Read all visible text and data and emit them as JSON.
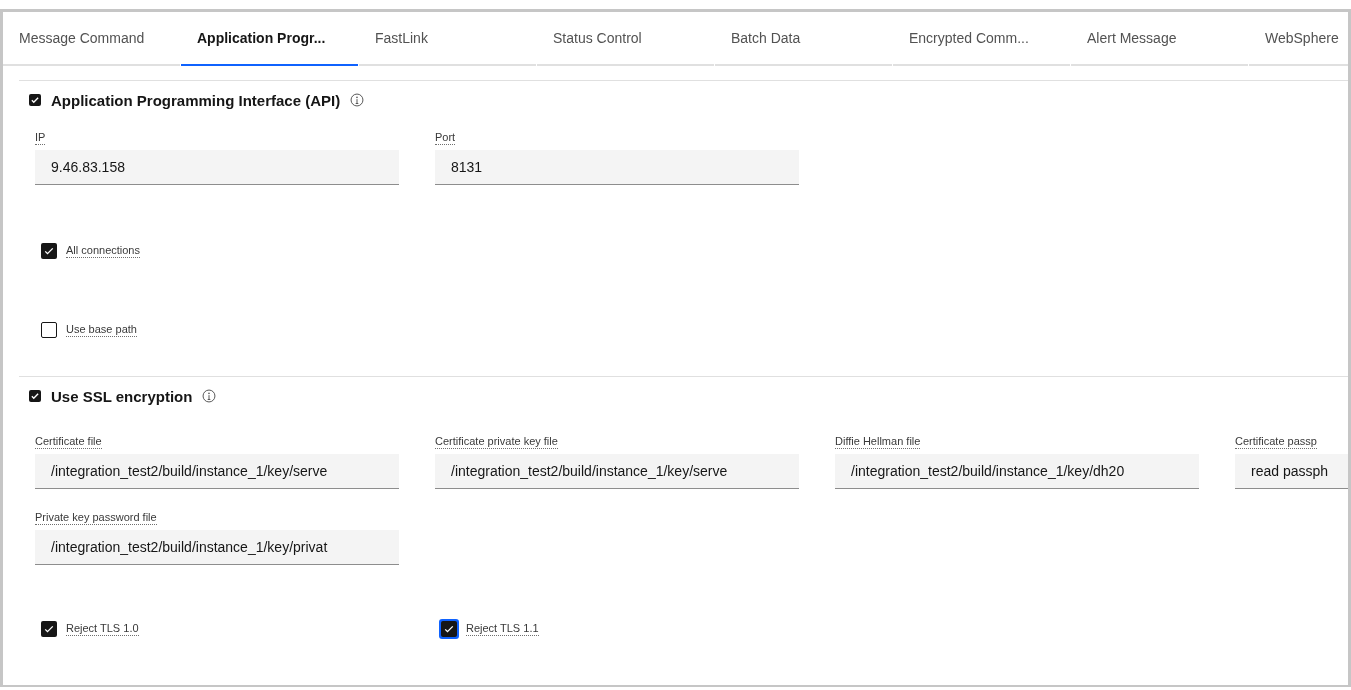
{
  "tabs": [
    {
      "label": "Message Command",
      "selected": false
    },
    {
      "label": "Application Progr...",
      "selected": true
    },
    {
      "label": "FastLink",
      "selected": false
    },
    {
      "label": "Status Control",
      "selected": false
    },
    {
      "label": "Batch Data",
      "selected": false
    },
    {
      "label": "Encrypted Comm...",
      "selected": false
    },
    {
      "label": "Alert Message",
      "selected": false
    },
    {
      "label": "WebSphere",
      "selected": false
    }
  ],
  "sections": [
    {
      "title": "Application Programming Interface (API)",
      "checked": true,
      "kind": "stack",
      "fields": [
        {
          "label": "IP",
          "value": "9.46.83.158"
        },
        {
          "label": "Port",
          "value": "8131"
        }
      ],
      "options": [
        {
          "label": "All connections",
          "checked": true,
          "focused": false
        },
        {
          "label": "Use base path",
          "checked": false,
          "focused": false
        }
      ]
    },
    {
      "title": "Use SSL encryption",
      "checked": true,
      "kind": "row",
      "fields": [
        {
          "label": "Certificate file",
          "value": "/integration_test2/build/instance_1/key/serve"
        },
        {
          "label": "Certificate private key file",
          "value": "/integration_test2/build/instance_1/key/serve"
        },
        {
          "label": "Diffie Hellman file",
          "value": "/integration_test2/build/instance_1/key/dh20"
        },
        {
          "label": "Certificate passp",
          "value": "read passph"
        },
        {
          "label": "Private key password file",
          "value": "/integration_test2/build/instance_1/key/privat"
        }
      ],
      "options": [
        {
          "label": "Reject TLS 1.0",
          "checked": true,
          "focused": false
        },
        {
          "label": "Reject TLS 1.1",
          "checked": true,
          "focused": true
        }
      ]
    }
  ]
}
